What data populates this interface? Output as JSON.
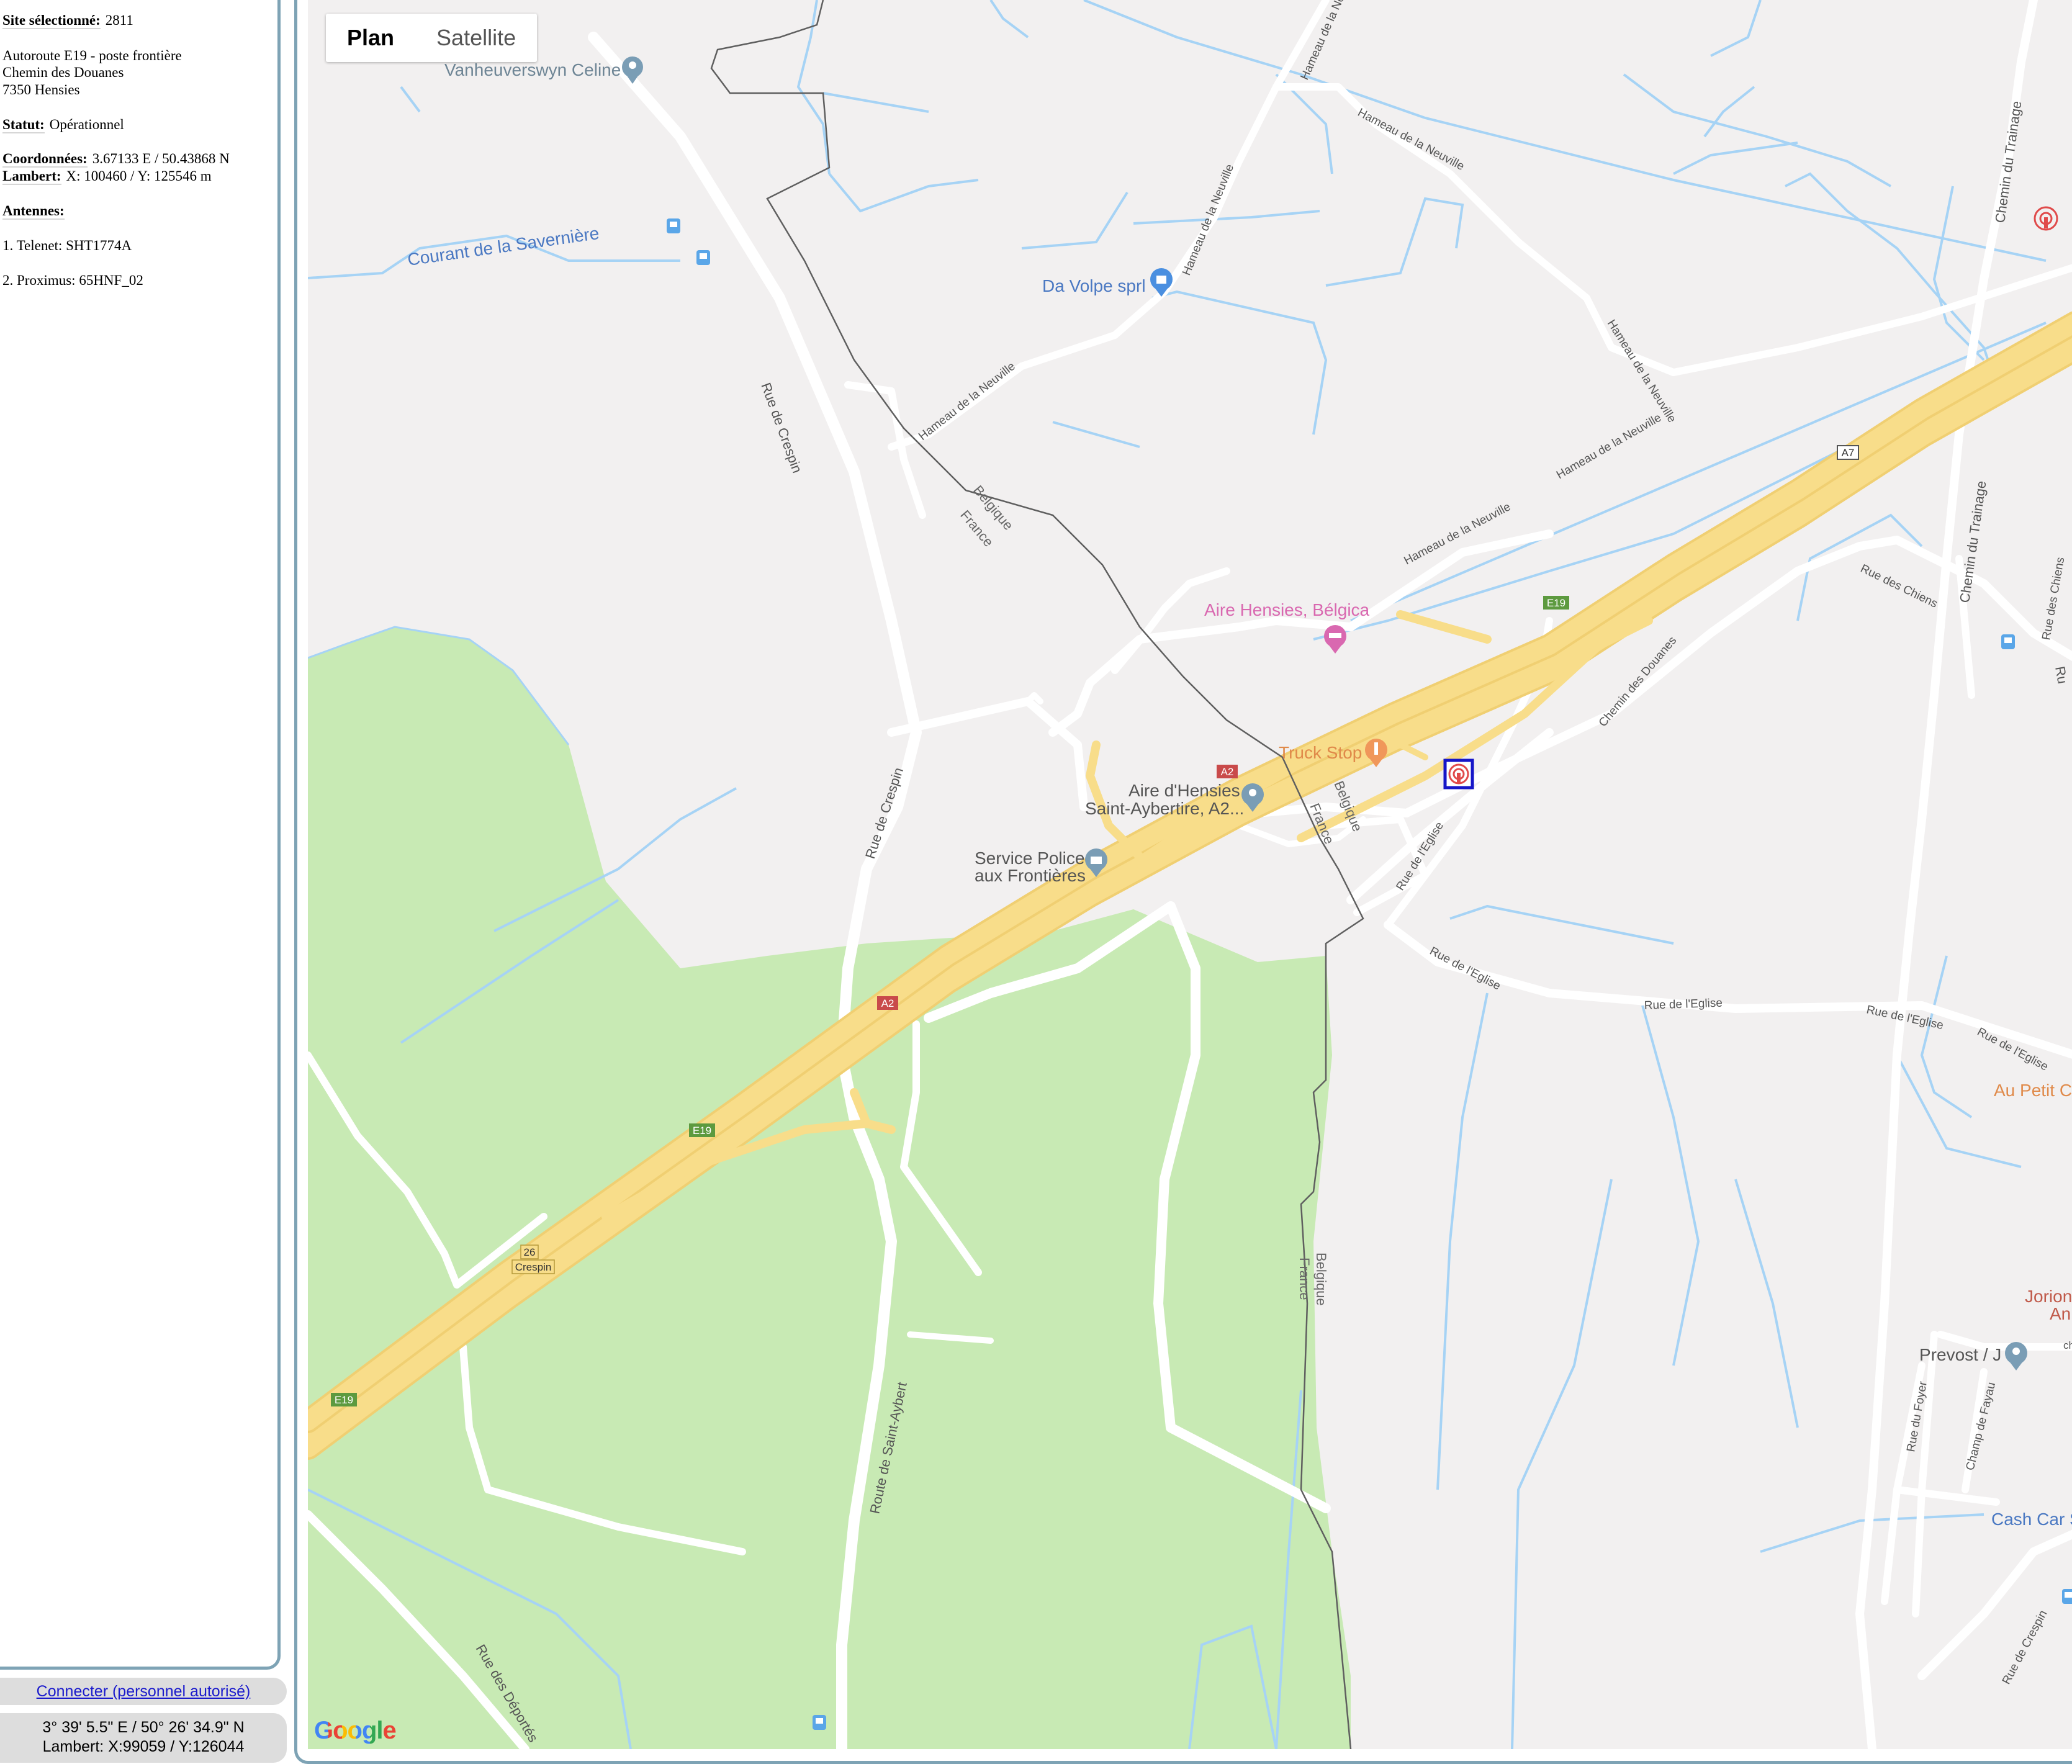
{
  "site": {
    "selected_label": "Site sélectionné:",
    "selected_value": "2811",
    "address": [
      "Autoroute E19 - poste frontière",
      "Chemin des Douanes",
      "7350 Hensies"
    ],
    "status_label": "Statut:",
    "status_value": "Opérationnel",
    "coords_label": "Coordonnées:",
    "coords_value": "3.67133 E / 50.43868 N",
    "lambert_label": "Lambert:",
    "lambert_value": "X: 100460 / Y: 125546 m",
    "antennas_label": "Antennes:",
    "antennas": [
      "1. Telenet: SHT1774A",
      "2. Proximus: 65HNF_02"
    ]
  },
  "login_link": "Connecter (personnel autorisé)",
  "cursor_position": {
    "dms": "3° 39' 5.5\" E / 50° 26' 34.9\" N",
    "lambert": "Lambert: X:99059 / Y:126044"
  },
  "map": {
    "type_buttons": [
      "Plan",
      "Satellite"
    ],
    "active_type": "Plan",
    "logo": "Google",
    "colors": {
      "background": "#f2f0f0",
      "forest": "#c8eab4",
      "water": "#a6d3f5",
      "highway": "#f8dd8a",
      "road": "#ffffff",
      "border": "#5f5f5f",
      "selected_site": "#1616c8",
      "other_site": "#e04a4a"
    },
    "pois": [
      {
        "name": "Vanheuverswyn Celine",
        "icon": "map-pin-icon"
      },
      {
        "name": "Da Volpe sprl",
        "icon": "shopping-bag-icon"
      },
      {
        "name": "Aire Hensies, Bélgica",
        "icon": "hotel-bed-icon"
      },
      {
        "name": "Truck Stop",
        "icon": "restaurant-fork-icon"
      },
      {
        "name": "Aire d'Hensies",
        "line2": "Saint-Aybertire, A2...",
        "icon": "map-pin-icon"
      },
      {
        "name": "Service Police",
        "line2": "aux Frontières",
        "icon": "police-building-icon"
      },
      {
        "name": "Prevost / J",
        "icon": "map-pin-icon"
      },
      {
        "name": "Jorion",
        "line2": "An",
        "icon": ""
      },
      {
        "name": "Au Petit Cr",
        "icon": ""
      },
      {
        "name": "Cash Car S",
        "icon": ""
      }
    ],
    "roads": {
      "rue_crespin": "Rue de Crespin",
      "hameau": "Hameau de la Neuville",
      "chemin_trainage": "Chemin du Trainage",
      "rue_chiens": "Rue des Chiens",
      "rue_chiens_short": "Rue des Chiens",
      "chemin_douanes": "Chemin des Douanes",
      "rue_eglise": "Rue de l'Eglise",
      "route_aybert": "Route de Saint-Aybert",
      "rue_deportes": "Rue des Déportés",
      "rue_foyer": "Rue du Foyer",
      "champ_fayau": "Champ de Fayau",
      "ru_cut": "Ru",
      "ch_cut": "ch",
      "courant": "Courant de la Savernière"
    },
    "border_labels": {
      "belgique": "Belgique",
      "france": "France"
    },
    "shields": {
      "e19": "E19",
      "a2": "A2",
      "a7": "A7",
      "exit_number": "26",
      "exit_name": "Crespin"
    }
  }
}
